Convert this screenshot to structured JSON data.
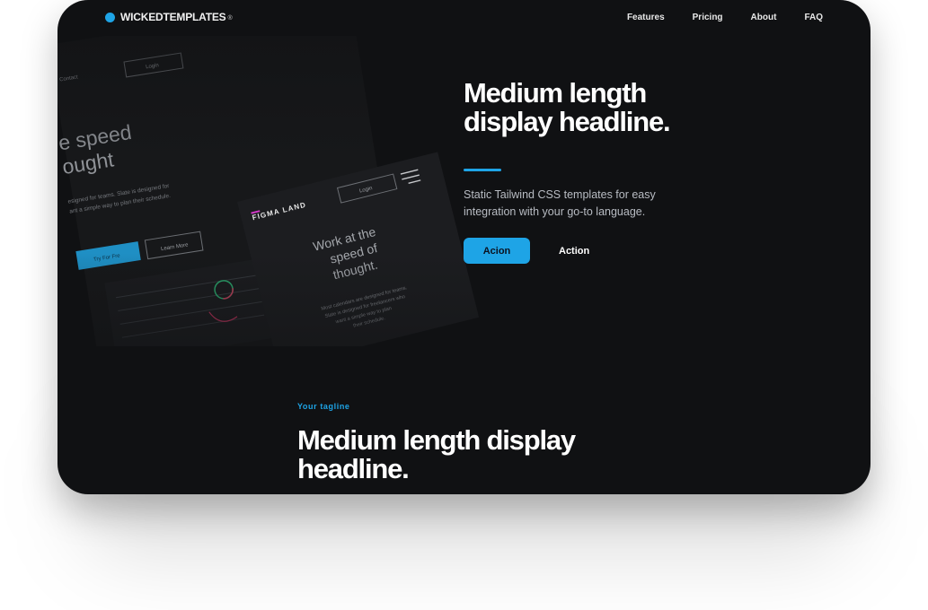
{
  "brand": {
    "name": "WICKEDTEMPLATES",
    "mark": "®"
  },
  "nav": {
    "items": [
      "Features",
      "Pricing",
      "About",
      "FAQ"
    ]
  },
  "mockup": {
    "nav_contact": "Contact",
    "login": "Login",
    "headline_line1": "e speed",
    "headline_line2": "ought",
    "desc_line1": "esigned for teams. Slate is designed for",
    "desc_line2": "ant a simple way to plan their schedule.",
    "try_btn": "Try For Fre",
    "learn_btn": "Learn More",
    "card_brand": "FIGMA LAND",
    "card_login": "Login",
    "card_title_line1": "Work at the",
    "card_title_line2": "speed of",
    "card_title_line3": "thought.",
    "card_desc_line1": "Most calendars are designed for teams.",
    "card_desc_line2": "Slate is designed for freelancers who",
    "card_desc_line3": "want a simple way to plan",
    "card_desc_line4": "their schedule."
  },
  "hero": {
    "title_line1": "Medium length",
    "title_line2": "display headline.",
    "subtitle": "Static Tailwind CSS templates for easy integration with your go-to language.",
    "primary_label": "Acion",
    "secondary_label": "Action"
  },
  "section2": {
    "tagline": "Your tagline",
    "title_line1": "Medium length display",
    "title_line2": "headline."
  },
  "colors": {
    "accent": "#1ea4e6",
    "background": "#101113",
    "accent_pink": "#d23ac8"
  }
}
